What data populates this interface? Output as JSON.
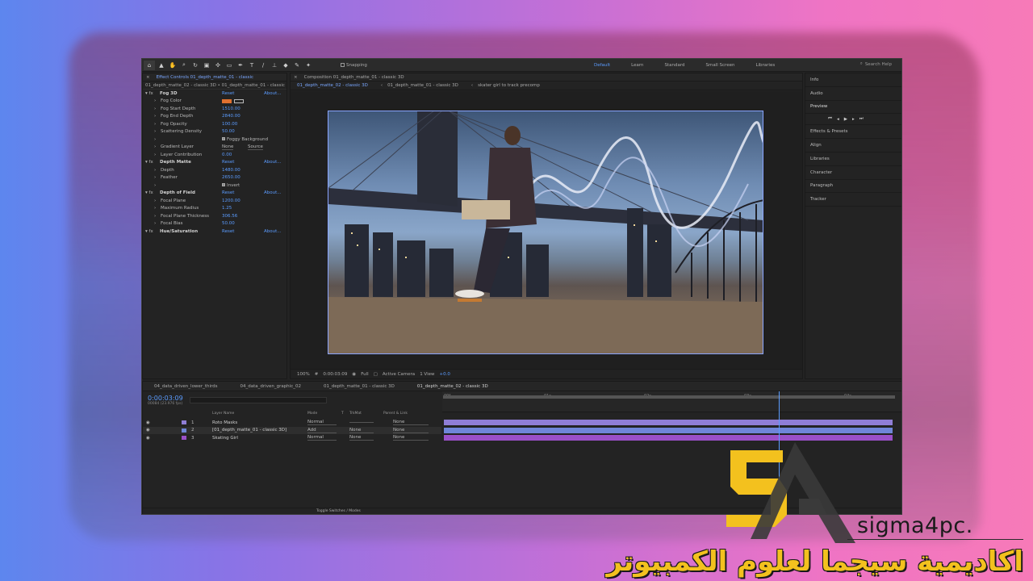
{
  "window": {
    "workspaces": [
      "Default",
      "Learn",
      "Standard",
      "Small Screen",
      "Libraries"
    ],
    "active_workspace": "Default",
    "search_help": "Search Help",
    "snapping": "Snapping"
  },
  "effect_controls": {
    "tab": "Effect Controls 01_depth_matte_01 - classic",
    "path": "01_depth_matte_02 - classic 3D • 01_depth_matte_01 - classic",
    "rows": [
      {
        "kind": "fx",
        "label": "Fog 3D",
        "reset": "Reset",
        "about": "About..."
      },
      {
        "kind": "prop",
        "label": "Fog Color"
      },
      {
        "kind": "prop",
        "label": "Fog Start Depth",
        "value": "1510.00"
      },
      {
        "kind": "prop",
        "label": "Fog End Depth",
        "value": "2840.00"
      },
      {
        "kind": "prop",
        "label": "Fog Opacity",
        "value": "100.00"
      },
      {
        "kind": "prop",
        "label": "Scattering Density",
        "value": "50.00"
      },
      {
        "kind": "check",
        "label": "Foggy Background"
      },
      {
        "kind": "prop",
        "label": "Gradient Layer",
        "value": "None",
        "value2": "Source"
      },
      {
        "kind": "prop",
        "label": "Layer Contribution",
        "value": "0.00"
      },
      {
        "kind": "fx",
        "label": "Depth Matte",
        "reset": "Reset",
        "about": "About..."
      },
      {
        "kind": "prop",
        "label": "Depth",
        "value": "1480.00"
      },
      {
        "kind": "prop",
        "label": "Feather",
        "value": "2650.00"
      },
      {
        "kind": "check",
        "label": "Invert"
      },
      {
        "kind": "fx",
        "label": "Depth of Field",
        "reset": "Reset",
        "about": "About..."
      },
      {
        "kind": "prop",
        "label": "Focal Plane",
        "value": "1200.00"
      },
      {
        "kind": "prop",
        "label": "Maximum Radius",
        "value": "1.25"
      },
      {
        "kind": "prop",
        "label": "Focal Plane Thickness",
        "value": "306.56"
      },
      {
        "kind": "prop",
        "label": "Focal Bias",
        "value": "50.00"
      },
      {
        "kind": "fx",
        "label": "Hue/Saturation",
        "reset": "Reset",
        "about": "About..."
      }
    ]
  },
  "composition": {
    "tab": "Composition 01_depth_matte_01 - classic 3D",
    "crumbs": [
      "01_depth_matte_02 - classic 3D",
      "01_depth_matte_01 - classic 3D",
      "skater girl to track precomp"
    ],
    "viewer": {
      "zoom": "100%",
      "timecode": "0:00:03:09",
      "resolution": "Full",
      "camera": "Active Camera",
      "views": "1 View",
      "exposure": "+0.0"
    }
  },
  "right_panel": {
    "items": [
      "Info",
      "Audio",
      "Preview",
      "Effects & Presets",
      "Align",
      "Libraries",
      "Character",
      "Paragraph",
      "Tracker"
    ]
  },
  "timeline": {
    "tabs": [
      "04_data_driven_lower_thirds",
      "04_data_driven_graphic_02",
      "01_depth_matte_01 - classic 3D",
      "01_depth_matte_02 - classic 3D"
    ],
    "active_tab": "01_depth_matte_02 - classic 3D",
    "timecode": "0:00:03:09",
    "fps": "00084 (23.976 fps)",
    "columns": {
      "name": "Layer Name",
      "mode": "Mode",
      "t": "T",
      "trkmat": "TrkMat",
      "parent": "Parent & Link"
    },
    "layers": [
      {
        "num": "1",
        "name": "Roto Masks",
        "mode": "Normal",
        "trkmat": "",
        "parent": "None",
        "color": "#8f7ed6"
      },
      {
        "num": "2",
        "name": "[01_depth_matte_01 - classic 3D]",
        "mode": "Add",
        "trkmat": "None",
        "parent": "None",
        "color": "#6f86d8"
      },
      {
        "num": "3",
        "name": "Skating Girl",
        "mode": "Normal",
        "trkmat": "None",
        "parent": "None",
        "color": "#9a50c8"
      }
    ],
    "ruler_ticks": [
      "00f",
      "01s",
      "02s",
      "03s",
      "04s"
    ],
    "toggle_label": "Toggle Switches / Modes"
  },
  "brand": {
    "name": "sigma4pc.",
    "arabic": "اكاديمية سيجما لعلوم الكمبيوتر",
    "colors": {
      "gold": "#f3c11e",
      "dark": "#3a3a3a"
    }
  }
}
